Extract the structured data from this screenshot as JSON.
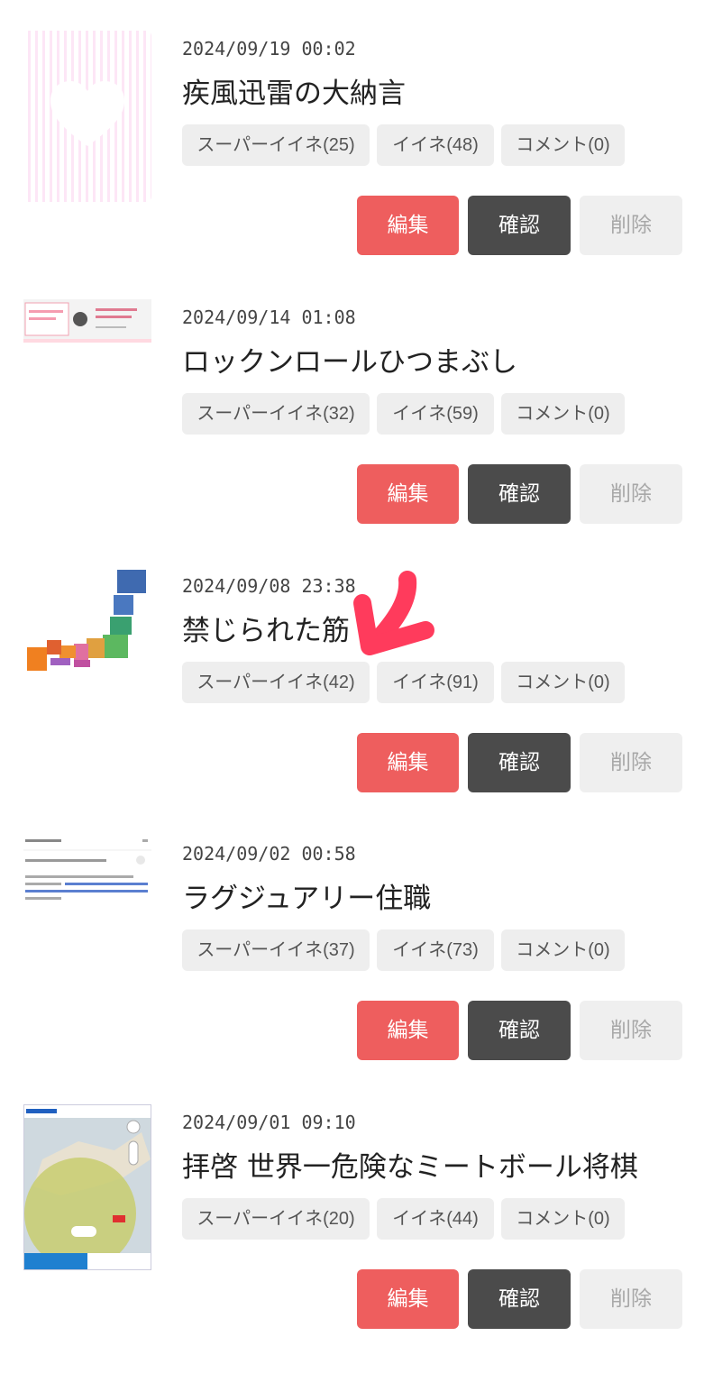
{
  "labels": {
    "edit": "編集",
    "confirm": "確認",
    "delete": "削除"
  },
  "posts": [
    {
      "date": "2024/09/19  00:02",
      "title": "疾風迅雷の大納言",
      "super_like": "スーパーイイネ(25)",
      "like": "イイネ(48)",
      "comment": "コメント(0)",
      "thumbnail_icon": "heart-pattern"
    },
    {
      "date": "2024/09/14  01:08",
      "title": "ロックンロールひつまぶし",
      "super_like": "スーパーイイネ(32)",
      "like": "イイネ(59)",
      "comment": "コメント(0)",
      "thumbnail_icon": "web-card"
    },
    {
      "date": "2024/09/08  23:38",
      "title": "禁じられた筋",
      "super_like": "スーパーイイネ(42)",
      "like": "イイネ(91)",
      "comment": "コメント(0)",
      "thumbnail_icon": "japan-map"
    },
    {
      "date": "2024/09/02  00:58",
      "title": "ラグジュアリー住職",
      "super_like": "スーパーイイネ(37)",
      "like": "イイネ(73)",
      "comment": "コメント(0)",
      "thumbnail_icon": "text-snippet"
    },
    {
      "date": "2024/09/01  09:10",
      "title": "拝啓  世界一危険なミートボール将棋",
      "super_like": "スーパーイイネ(20)",
      "like": "イイネ(44)",
      "comment": "コメント(0)",
      "thumbnail_icon": "weather-map"
    }
  ],
  "annotation": {
    "icon": "red-arrow-down-left-icon",
    "color": "#ff3b5c"
  },
  "colors": {
    "edit": "#ee5e5e",
    "confirm": "#4b4b4b",
    "delete": "#efefef"
  }
}
